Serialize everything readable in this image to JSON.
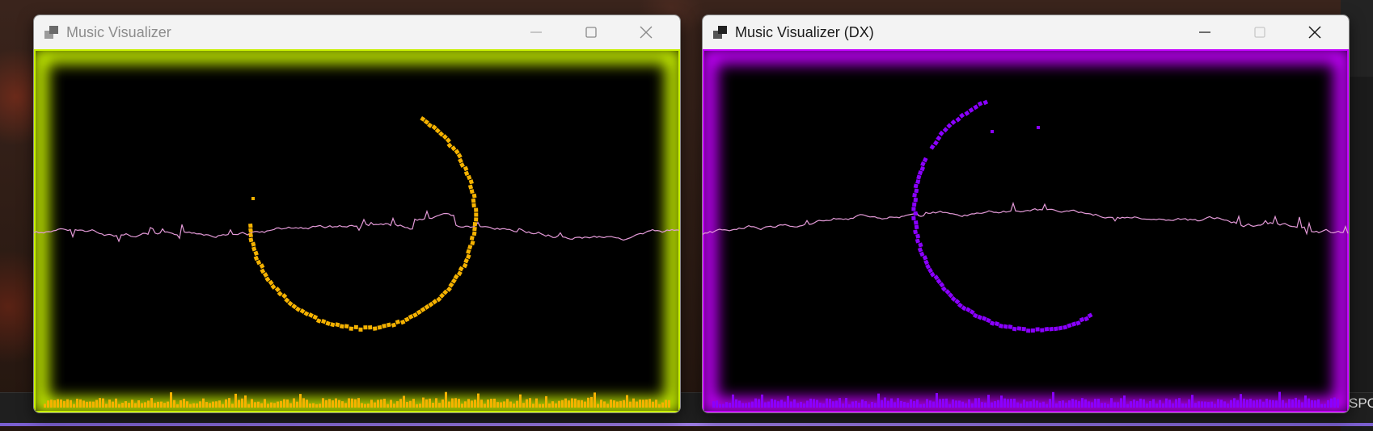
{
  "windows": [
    {
      "id": "win1",
      "title": "Music Visualizer",
      "title_active": false,
      "glow_color": "#c8f000",
      "accent_color": "#f5b200",
      "waveform_color": "#e49ad8",
      "controls": {
        "minimize": "minimize-icon",
        "maximize": "maximize-icon",
        "close": "close-icon"
      }
    },
    {
      "id": "win2",
      "title": "Music Visualizer (DX)",
      "title_active": true,
      "glow_color": "#c400ff",
      "accent_color": "#8a00ff",
      "waveform_color": "#e49ad8",
      "controls": {
        "minimize": "minimize-icon",
        "maximize": "maximize-icon",
        "close": "close-icon"
      }
    }
  ],
  "taskbar": {
    "clipped_text": "SPC"
  }
}
